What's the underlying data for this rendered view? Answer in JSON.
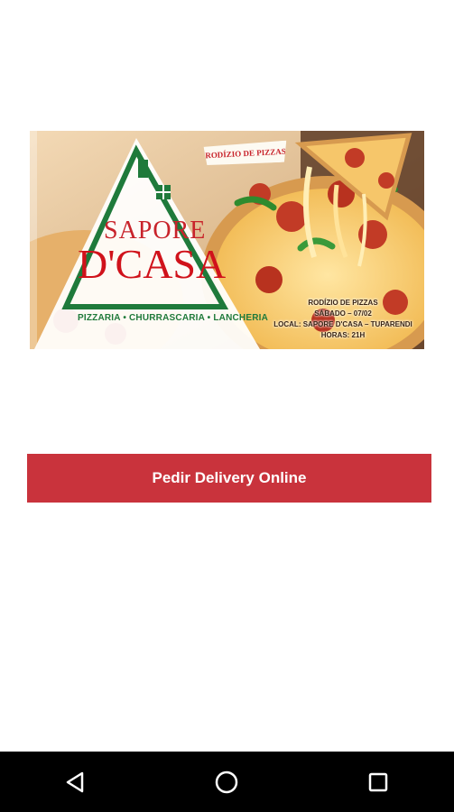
{
  "banner": {
    "rodizio_badge": "RODÍZIO DE PIZZAS",
    "brand_top": "SAPORE",
    "brand_main": "D'CASA",
    "brand_tags": "PIZZARIA • CHURRASCARIA • LANCHERIA",
    "promo_lines": [
      "RODÍZIO DE PIZZAS",
      "SÁBADO – 07/02",
      "LOCAL: SAPORE D'CASA – TUPARENDI",
      "HORAS: 21H"
    ]
  },
  "cta": {
    "label": "Pedir Delivery Online"
  },
  "navbar": {
    "back": "back-icon",
    "home": "home-icon",
    "recents": "recents-icon"
  },
  "colors": {
    "brand_red": "#c9333c",
    "brand_green": "#1f7a3b",
    "navbar": "#000000"
  }
}
